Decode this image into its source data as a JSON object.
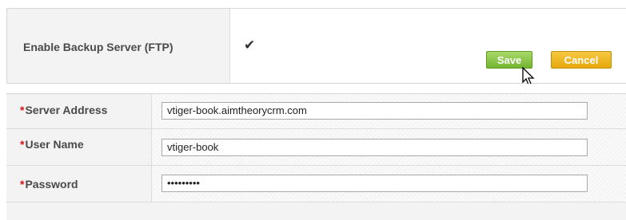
{
  "backup": {
    "label": "Enable Backup Server (FTP)",
    "enabled_mark": "✔"
  },
  "actions": {
    "save_label": "Save",
    "cancel_label": "Cancel"
  },
  "form": {
    "required_marker": "*",
    "server_address_label": "Server Address",
    "server_address_value": "vtiger-book.aimtheorycrm.com",
    "user_name_label": "User Name",
    "user_name_value": "vtiger-book",
    "password_label": "Password",
    "password_value": "•••••••••"
  },
  "colors": {
    "save_button": "#8cc43f",
    "cancel_button": "#f0b91f",
    "required_marker": "#dd1111"
  }
}
